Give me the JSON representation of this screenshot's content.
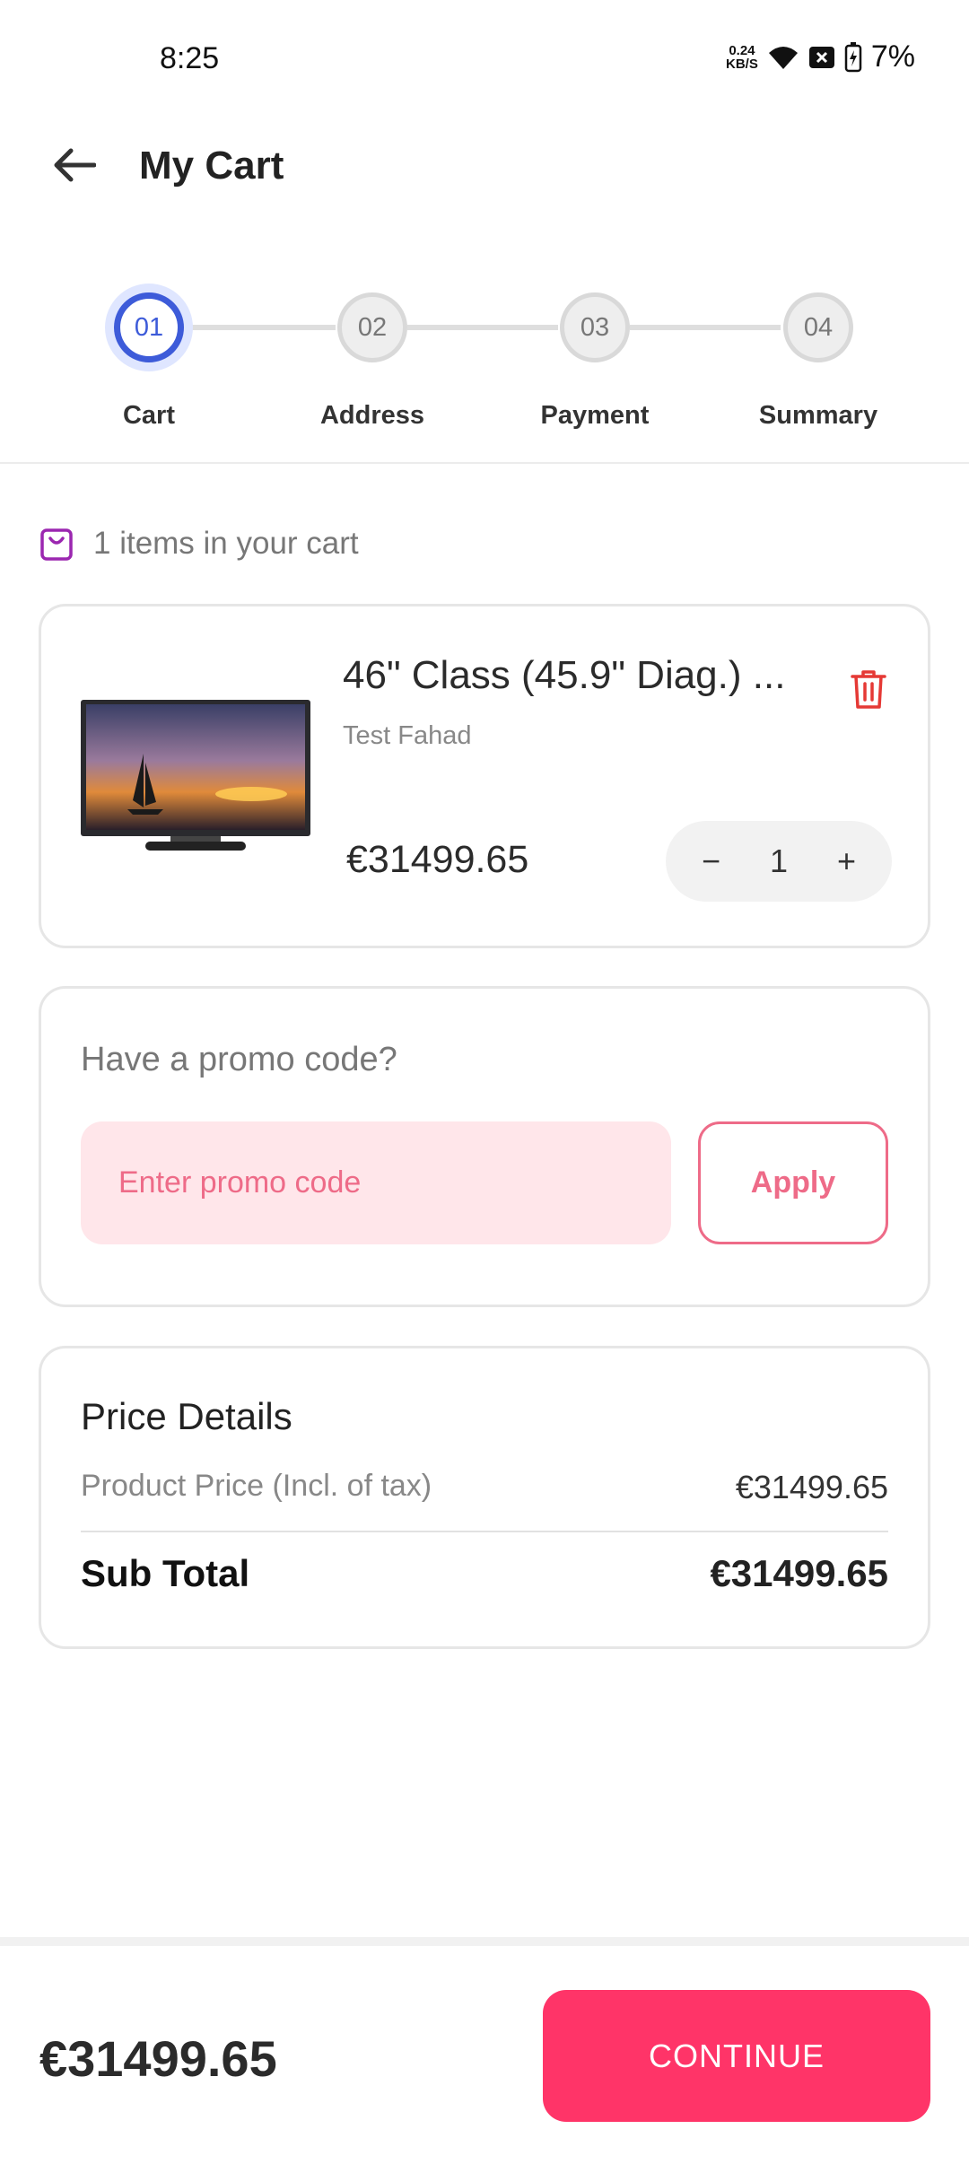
{
  "status_bar": {
    "time": "8:25",
    "speed_value": "0.24",
    "speed_unit": "KB/S",
    "battery": "7%"
  },
  "header": {
    "title": "My Cart",
    "back_icon": "arrow-left-icon"
  },
  "stepper": {
    "steps": [
      {
        "number": "01",
        "label": "Cart",
        "active": true
      },
      {
        "number": "02",
        "label": "Address",
        "active": false
      },
      {
        "number": "03",
        "label": "Payment",
        "active": false
      },
      {
        "number": "04",
        "label": "Summary",
        "active": false
      }
    ]
  },
  "cart": {
    "items_count_text": "1 items in your cart",
    "item": {
      "name": "46\" Class (45.9\" Diag.) ...",
      "seller": "Test Fahad",
      "price": "€31499.65",
      "quantity": "1"
    }
  },
  "promo": {
    "title": "Have a promo code?",
    "placeholder": "Enter promo code",
    "apply_label": "Apply"
  },
  "price_details": {
    "title": "Price Details",
    "product_price_label": "Product Price (Incl. of tax)",
    "product_price_value": "€31499.65",
    "subtotal_label": "Sub Total",
    "subtotal_value": "€31499.65"
  },
  "footer": {
    "total": "€31499.65",
    "continue_label": "CONTINUE"
  },
  "colors": {
    "accent_blue": "#3d5bd9",
    "accent_pink": "#ff3468",
    "promo_bg": "#ffe6ea",
    "promo_text": "#ee6b88",
    "delete_red": "#e53935",
    "bag_purple": "#9b27b0"
  }
}
